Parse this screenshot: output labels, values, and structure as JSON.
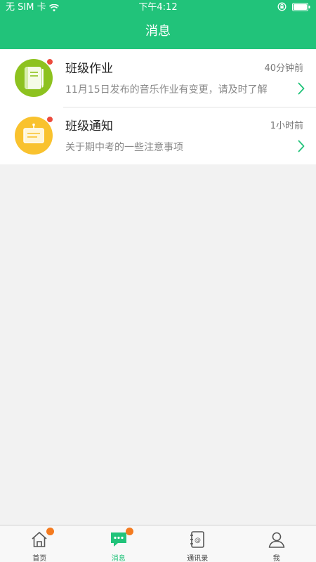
{
  "status_bar": {
    "carrier": "无 SIM 卡",
    "time": "下午4:12"
  },
  "header": {
    "title": "消息"
  },
  "messages": [
    {
      "title": "班级作业",
      "time": "40分钟前",
      "subtitle": "11月15日发布的音乐作业有变更，请及时了解",
      "icon": "homework-book-icon",
      "icon_color": "#8dc21f",
      "unread": true
    },
    {
      "title": "班级通知",
      "time": "1小时前",
      "subtitle": "关于期中考的一些注意事项",
      "icon": "notice-board-icon",
      "icon_color": "#f9c22e",
      "unread": true
    }
  ],
  "tabbar": {
    "items": [
      {
        "label": "首页",
        "icon": "home-icon",
        "badge": true,
        "active": false
      },
      {
        "label": "消息",
        "icon": "message-icon",
        "badge": true,
        "active": true
      },
      {
        "label": "通讯录",
        "icon": "contacts-icon",
        "badge": false,
        "active": false
      },
      {
        "label": "我",
        "icon": "profile-icon",
        "badge": false,
        "active": false
      }
    ]
  },
  "colors": {
    "brand": "#21c37a",
    "badge_red": "#ec4b3d",
    "badge_orange": "#f47b20"
  }
}
